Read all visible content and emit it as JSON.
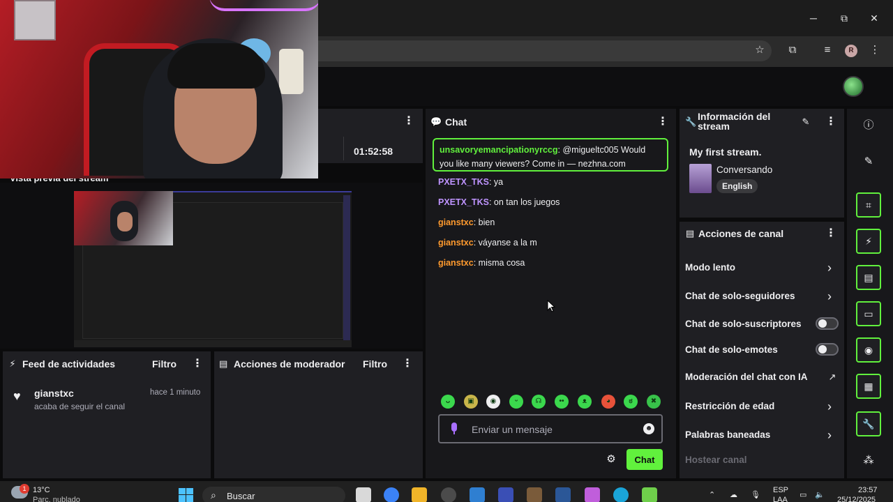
{
  "browser": {
    "profile_initial": "R",
    "window_controls": {
      "minimize": "─",
      "maximize": "⧉",
      "close": "✕"
    }
  },
  "stream_stats": {
    "uptime": "01:52:58"
  },
  "preview": {
    "title": "Vista previa del stream"
  },
  "activity_feed": {
    "title": "Feed de actividades",
    "filter_label": "Filtro",
    "items": [
      {
        "user": "gianstxc",
        "time": "hace 1 minuto",
        "text": "acaba de seguir el canal"
      }
    ]
  },
  "mod_actions": {
    "title": "Acciones de moderador",
    "filter_label": "Filtro"
  },
  "chat": {
    "title": "Chat",
    "highlight": {
      "user": "unsavoryemancipationyrccg",
      "text": " @migueltc005 Would you like many viewers? Come in — nezhna.com"
    },
    "messages": [
      {
        "user": "PXETX_TKS",
        "text": " ya",
        "color": "purple"
      },
      {
        "user": "PXETX_TKS",
        "text": " on tan los juegos",
        "color": "purple"
      },
      {
        "user": "gianstxc",
        "text": " bien",
        "color": "orange"
      },
      {
        "user": "gianstxc",
        "text": " váyanse a la m",
        "color": "orange"
      },
      {
        "user": "gianstxc",
        "text": " misma cosa",
        "color": "orange"
      }
    ],
    "input_placeholder": "Enviar un mensaje",
    "send_label": "Chat",
    "accent_color": "#61f13d"
  },
  "stream_info": {
    "title": "Información del stream",
    "stream_title": "My first stream.",
    "category": "Conversando",
    "tag": "English"
  },
  "channel_actions": {
    "title": "Acciones de canal",
    "rows": [
      {
        "label": "Modo lento",
        "control": "chevron"
      },
      {
        "label": "Chat de solo-seguidores",
        "control": "chevron"
      },
      {
        "label": "Chat de solo-suscriptores",
        "control": "toggle"
      },
      {
        "label": "Chat de solo-emotes",
        "control": "toggle"
      },
      {
        "label": "Moderación del chat con IA",
        "control": "external"
      },
      {
        "label": "Restricción de edad",
        "control": "chevron"
      },
      {
        "label": "Palabras baneadas",
        "control": "chevron"
      },
      {
        "label": "Hostear canal",
        "control": "none"
      }
    ]
  },
  "taskbar": {
    "weather_temp": "13°C",
    "weather_desc": "Parc. nublado",
    "search_label": "Buscar",
    "language": "ESP",
    "language_sub": "LAA",
    "time": "23:57",
    "date": "25/12/2025"
  }
}
